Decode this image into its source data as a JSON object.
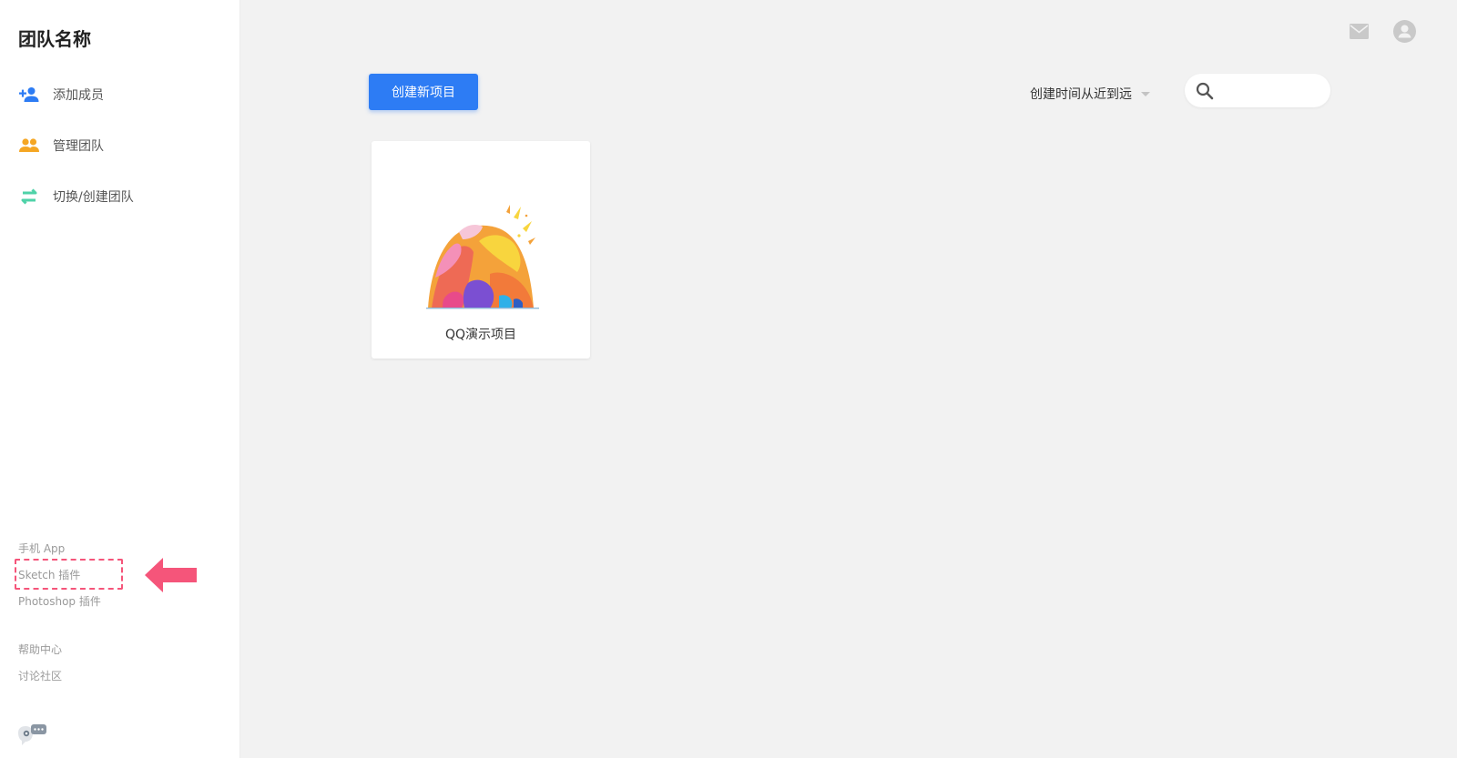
{
  "sidebar": {
    "team_name": "团队名称",
    "nav": [
      {
        "label": "添加成员",
        "icon": "add-member-icon",
        "color": "#2d7cf4"
      },
      {
        "label": "管理团队",
        "icon": "manage-team-icon",
        "color": "#f5a623"
      },
      {
        "label": "切换/创建团队",
        "icon": "switch-team-icon",
        "color": "#4fd2a8"
      }
    ],
    "footer_links": {
      "mobile_app": "手机 App",
      "sketch_plugin": "Sketch 插件",
      "photoshop_plugin": "Photoshop 插件",
      "help_center": "帮助中心",
      "community": "讨论社区"
    }
  },
  "toolbar": {
    "create_label": "创建新项目",
    "sort_label": "创建时间从近到远",
    "search_placeholder": ""
  },
  "projects": [
    {
      "name": "QQ演示项目"
    }
  ],
  "colors": {
    "primary": "#2d7cf4",
    "highlight": "#f5557a",
    "background": "#f2f2f2"
  }
}
